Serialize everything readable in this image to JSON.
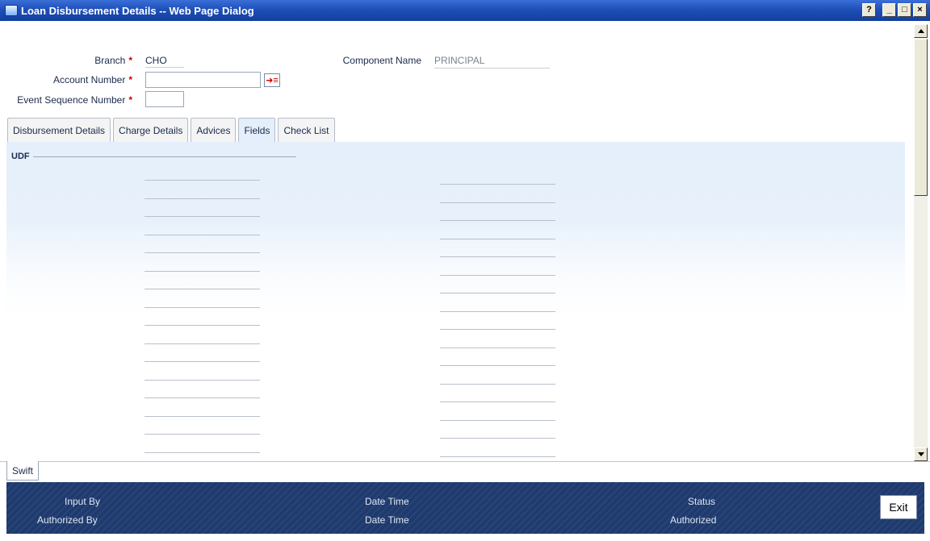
{
  "window": {
    "title": "Loan Disbursement Details -- Web Page Dialog",
    "buttons": {
      "help": "?",
      "minimize": "_",
      "maximize": "□",
      "close": "×"
    }
  },
  "header": {
    "branch": {
      "label": "Branch",
      "value": "CHO"
    },
    "account_number": {
      "label": "Account Number",
      "value": ""
    },
    "event_sequence": {
      "label": "Event Sequence Number",
      "value": ""
    },
    "component_name": {
      "label": "Component Name",
      "value": "PRINCIPAL"
    },
    "required_mark": "*",
    "lov_icon": "list-arrow-icon"
  },
  "tabs": [
    {
      "label": "Disbursement Details",
      "active": false
    },
    {
      "label": "Charge Details",
      "active": false
    },
    {
      "label": "Advices",
      "active": false
    },
    {
      "label": "Fields",
      "active": true
    },
    {
      "label": "Check List",
      "active": false
    }
  ],
  "udf": {
    "legend": "UDF",
    "left_fields": [
      "",
      "",
      "",
      "",
      "",
      "",
      "",
      "",
      "",
      "",
      "",
      "",
      "",
      "",
      "",
      ""
    ],
    "right_fields": [
      "",
      "",
      "",
      "",
      "",
      "",
      "",
      "",
      "",
      "",
      "",
      "",
      "",
      "",
      "",
      ""
    ]
  },
  "bottom_tabs": [
    {
      "label": "Swift"
    }
  ],
  "footer": {
    "input_by": "Input By",
    "authorized_by": "Authorized By",
    "date_time_1": "Date Time",
    "date_time_2": "Date Time",
    "status": "Status",
    "authorized": "Authorized",
    "exit": "Exit"
  },
  "colors": {
    "title_bar": "#1f4fb8",
    "panel_background": "#e4effb",
    "footer_background": "#1e3a6e",
    "required_star": "#d00000"
  }
}
